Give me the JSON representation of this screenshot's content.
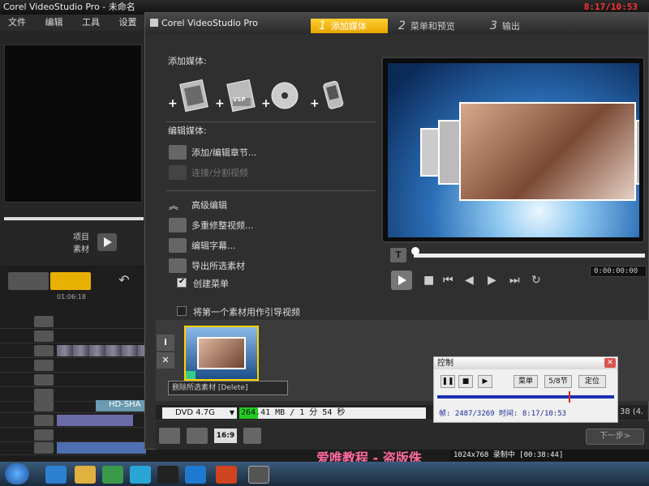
{
  "bg_app": {
    "title": "Corel VideoStudio Pro - 未命名",
    "clock": "8:17/10:53",
    "menu": [
      "文件",
      "编辑",
      "工具",
      "设置"
    ],
    "project_label": "项目",
    "clip_label": "素材",
    "timeline_clip_label": "HD-SHA",
    "timeline_time": "01:06:18"
  },
  "dialog": {
    "title": "Corel VideoStudio Pro",
    "steps": [
      {
        "num": "1",
        "label": "添加媒体",
        "active": true
      },
      {
        "num": "2",
        "label": "菜单和预览",
        "active": false
      },
      {
        "num": "3",
        "label": "输出",
        "active": false
      }
    ],
    "add_media_label": "添加媒体:",
    "edit_media_label": "编辑媒体:",
    "media_icons": [
      "video-icon",
      "vsp-project-icon",
      "disc-icon",
      "device-icon"
    ],
    "vsp_text": "VSP",
    "edit_items": [
      {
        "label": "添加/编辑章节...",
        "enabled": true
      },
      {
        "label": "连接/分割视频",
        "enabled": false
      }
    ],
    "advanced_label": "高级编辑",
    "advanced_items": [
      {
        "label": "多重修整视频..."
      },
      {
        "label": "编辑字幕..."
      },
      {
        "label": "导出所选素材"
      }
    ],
    "create_menu_label": "创建菜单",
    "create_menu_checked": true,
    "intro_label": "将第一个素材用作引导视频",
    "intro_checked": false,
    "timecode": "0:00:00:00",
    "tooltip": "删除所选素材 [Delete]",
    "info_btn": "i",
    "delete_btn": "✕",
    "disc_type": "DVD 4.7G",
    "capacity_text": "264.41 MB / 1 分 54 秒",
    "capacity_fraction": 0.1,
    "right_count": "38 (4.",
    "aspect": "16:9",
    "next_btn": "下一步>"
  },
  "control_popup": {
    "title": "控制",
    "menu_btn": "菜单",
    "chapter": "5/8节",
    "locate_btn": "定位",
    "info": "帧: 2487/3269 时间: 8:17/10:53"
  },
  "rec_status": "1024x768  录制中 [00:38:44]",
  "watermark": "爱唯教程 - 盗版侏"
}
